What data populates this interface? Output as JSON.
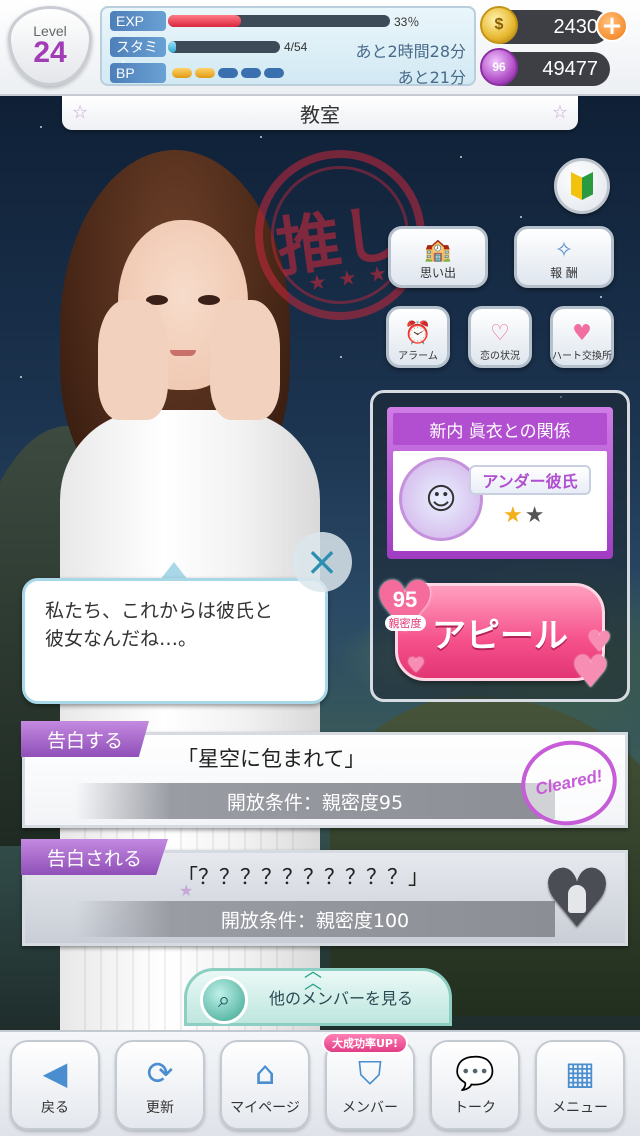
{
  "header": {
    "level_label": "Level",
    "level_value": "24",
    "exp_label": "EXP",
    "exp_percent_text": "33％",
    "exp_fraction": 0.33,
    "stamina_label": "スタミナ",
    "stamina_value": "4/54",
    "stamina_fraction": 0.074,
    "stamina_timer": "あと2時間28分",
    "bp_label": "BP",
    "bp_filled": 2,
    "bp_total": 5,
    "bp_timer": "あと21分",
    "gold_amount": "2430",
    "gold_icon_text": "$",
    "heart_coin_amount": "49477",
    "heart_coin_icon_text": "96"
  },
  "location": {
    "title": "教室"
  },
  "stamp": {
    "text": "推し"
  },
  "actions": {
    "memories_label": "思い出",
    "rewards_label": "報 酬",
    "alarm_label": "アラーム",
    "love_status_label": "恋の状況",
    "heart_exchange_label": "ハート交換所"
  },
  "relationship": {
    "title": "新内 眞衣との関係",
    "status": "アンダー彼氏",
    "stars_filled": 1,
    "stars_total": 2,
    "intimacy_value": "95",
    "intimacy_label": "親密度",
    "appeal_label": "アピール"
  },
  "dialog": {
    "line1": "私たち、これからは彼氏と",
    "line2": "彼女なんだね…。"
  },
  "confessions": [
    {
      "tag": "告白する",
      "title": "「星空に包まれて」",
      "condition": "開放条件：親密度95",
      "cleared_label": "Cleared!"
    },
    {
      "tag": "告白される",
      "title": "「？？？？？？？？？？」",
      "condition": "開放条件：親密度100"
    }
  ],
  "other_members": {
    "label": "他のメンバーを見る"
  },
  "bottom_nav": {
    "items": [
      {
        "label": "戻る",
        "icon": "back-arrow-icon"
      },
      {
        "label": "更新",
        "icon": "refresh-icon"
      },
      {
        "label": "マイページ",
        "icon": "house-icon"
      },
      {
        "label": "メンバー",
        "icon": "member-shield-icon"
      },
      {
        "label": "トーク",
        "icon": "chat-bubbles-icon"
      },
      {
        "label": "メニュー",
        "icon": "grid-menu-icon"
      }
    ],
    "success_badge": "大成功率UP!"
  },
  "colors": {
    "accent_purple": "#a23cb6",
    "appeal_pink": "#f5508a",
    "exp_bar": "#e8475c",
    "stamina_bar": "#4fc3e6"
  }
}
